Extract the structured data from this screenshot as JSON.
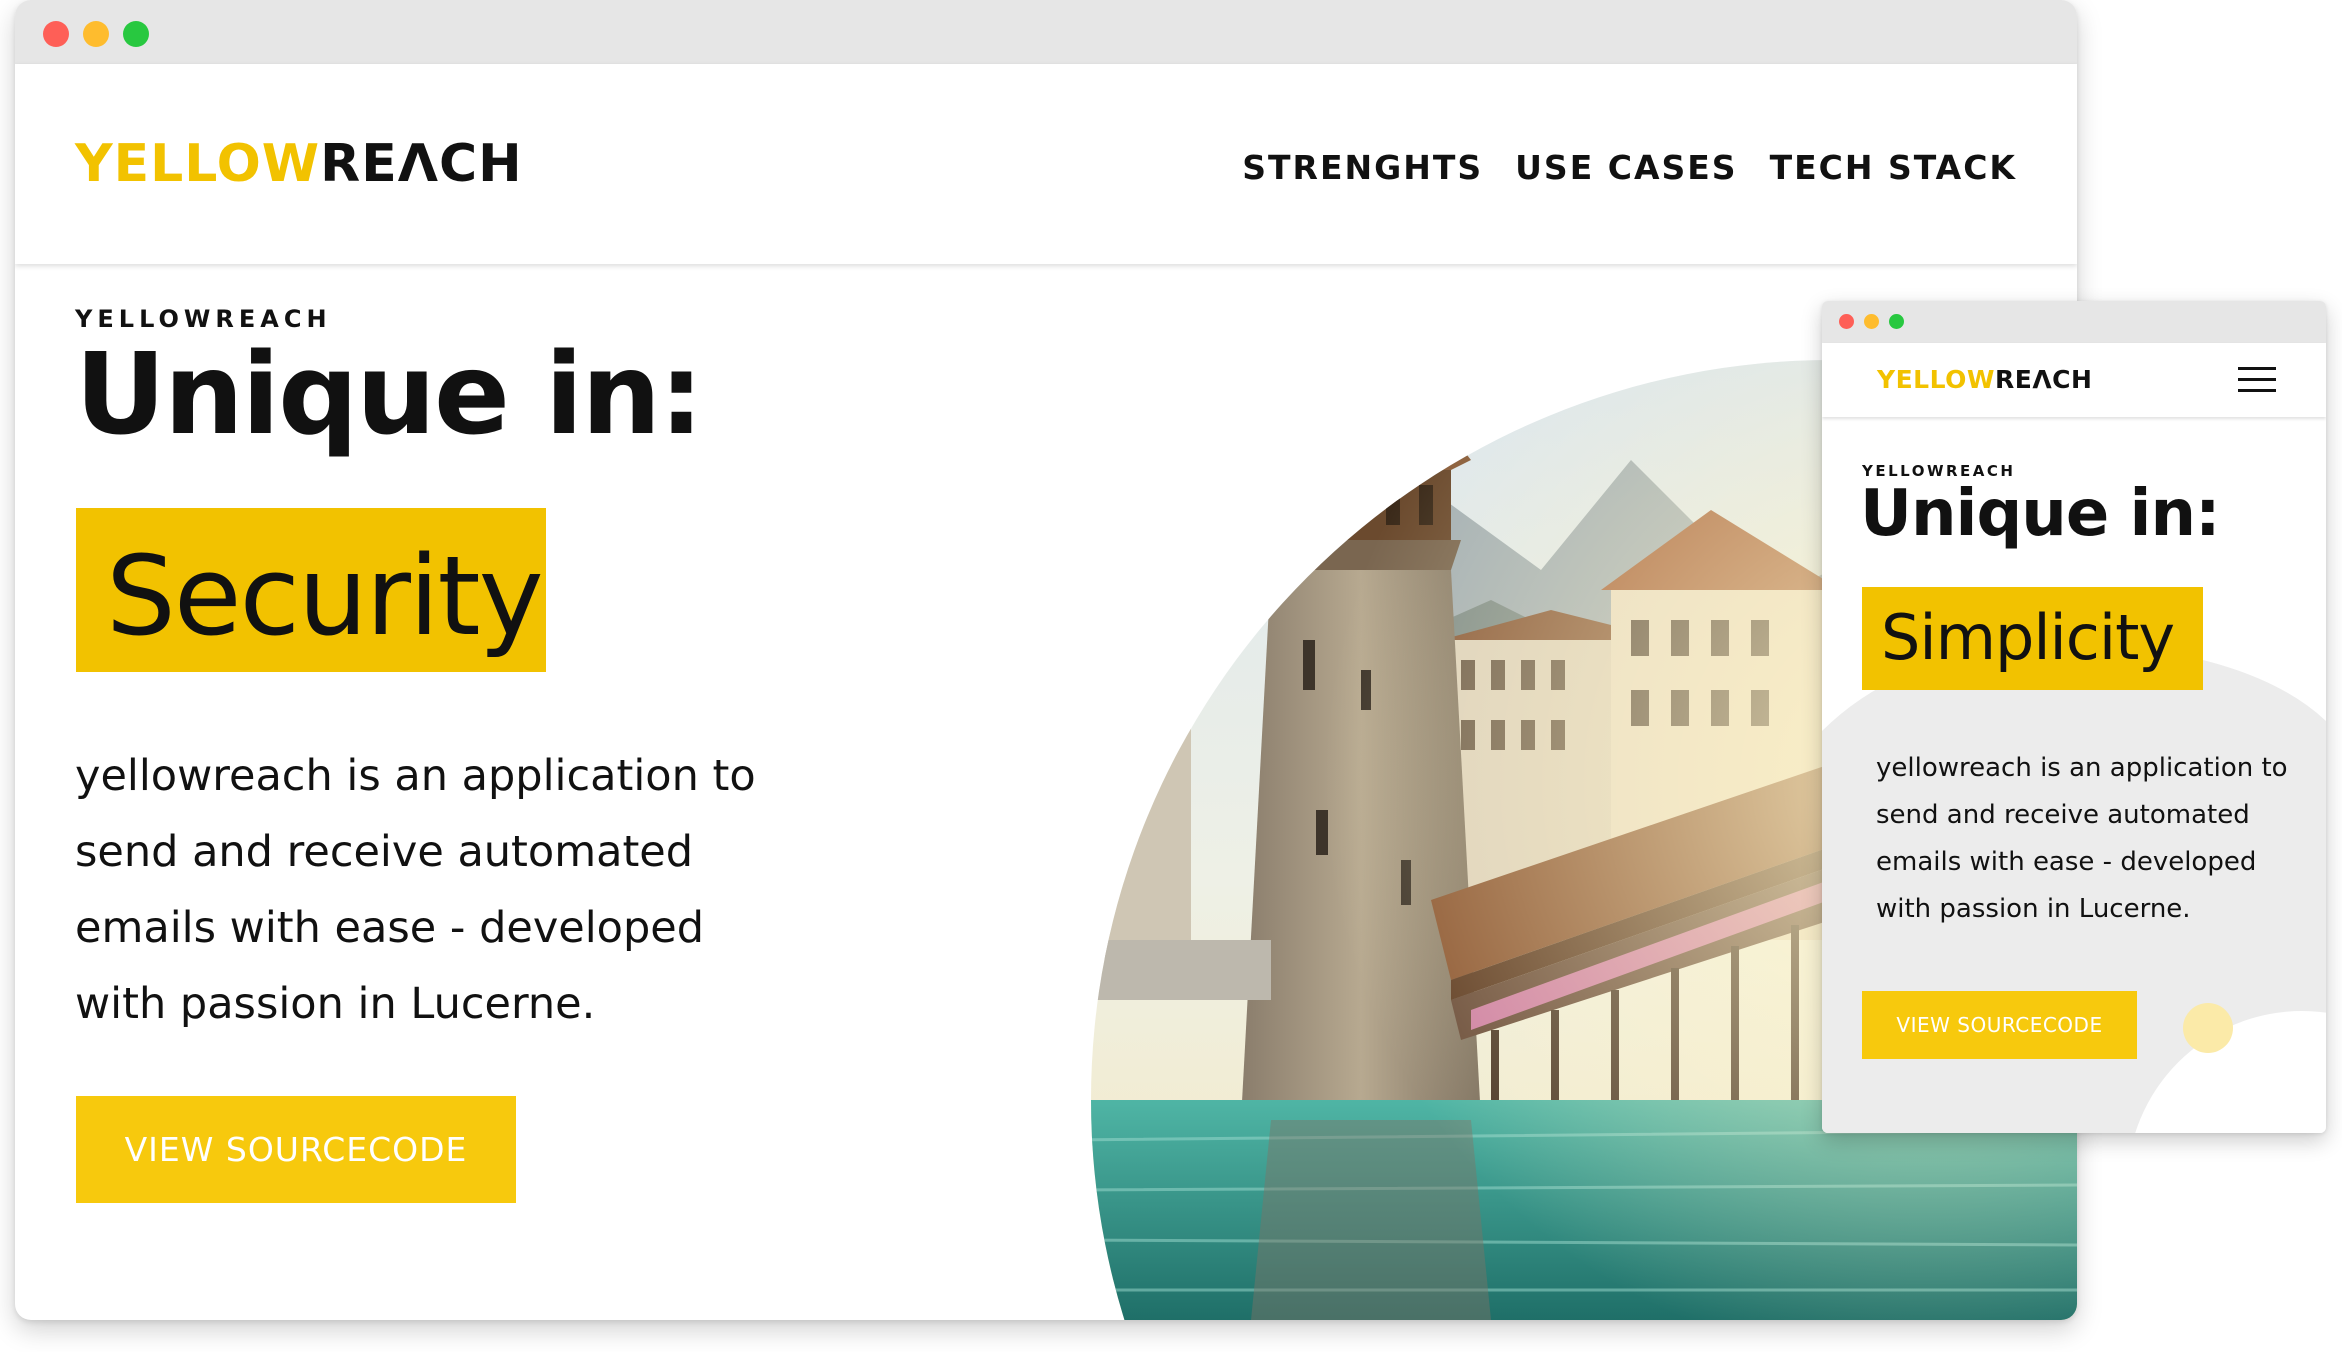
{
  "brand": {
    "logo_part1": "YELLOW",
    "logo_part2": "REΛCH",
    "accent": "#f2c200",
    "button": "#f7c90d"
  },
  "desktop": {
    "nav": [
      "STRENGHTS",
      "USE CASES",
      "TECH STACK"
    ],
    "eyebrow": "YELLOWREACH",
    "headline": "Unique in:",
    "highlight": "Security",
    "description": "yellowreach is an application to send and receive automated emails with ease - developed with passion in Lucerne.",
    "cta": "VIEW SOURCECODE",
    "image": "lucerne-chapel-bridge-water-tower-photo"
  },
  "mobile": {
    "eyebrow": "YELLOWREACH",
    "headline": "Unique in:",
    "highlight": "Simplicity",
    "description": "yellowreach is an application to send and receive automated emails with ease - developed with passion in Lucerne.",
    "cta": "VIEW SOURCECODE",
    "menu_icon": "hamburger-menu-icon"
  }
}
